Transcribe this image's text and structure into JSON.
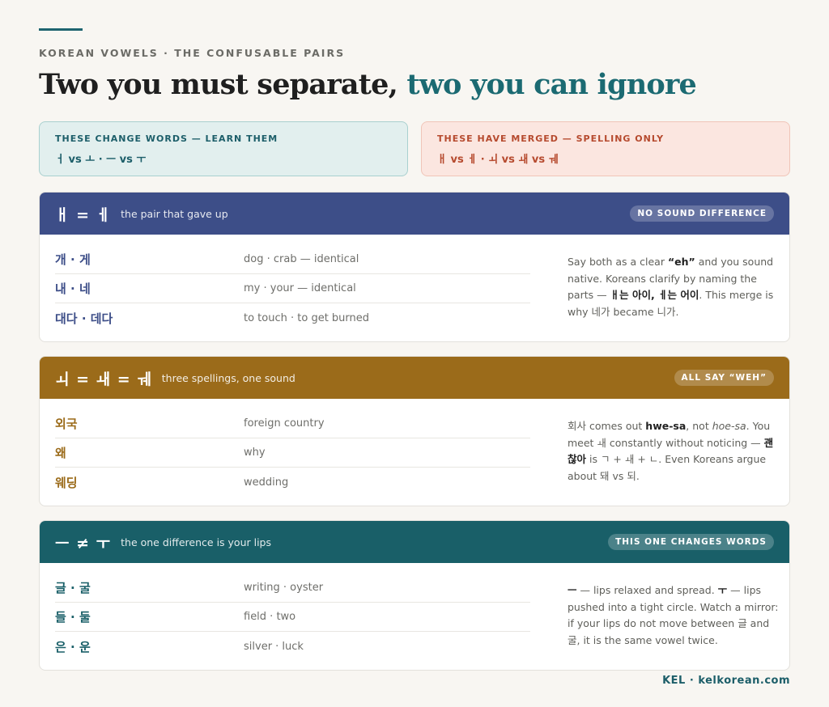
{
  "eyebrow": "KOREAN VOWELS · THE CONFUSABLE PAIRS",
  "headline": {
    "part1": "Two you must separate, ",
    "part2": "two you can ignore"
  },
  "callouts": {
    "learn": {
      "title": "THESE CHANGE WORDS — LEARN THEM",
      "body": "ㅓ vs ㅗ · ㅡ vs ㅜ"
    },
    "merged": {
      "title": "THESE HAVE MERGED — SPELLING ONLY",
      "body": "ㅐ vs ㅔ · ㅚ vs ㅙ vs ㅞ"
    }
  },
  "cards": [
    {
      "glyphs": "ㅐ = ㅔ",
      "subtitle": "the pair that gave up",
      "badge": "NO SOUND DIFFERENCE",
      "rows": [
        {
          "word": "개 · 게",
          "gloss": "dog · crab — identical"
        },
        {
          "word": "내 · 네",
          "gloss": "my · your — identical"
        },
        {
          "word": "대다 · 데다",
          "gloss": "to touch · to get burned"
        }
      ],
      "note": {
        "t1": "Say both as a clear ",
        "b1": "“eh”",
        "t2": " and you sound native. Koreans clarify by naming the parts — ",
        "b2": "ㅐ는 아이, ㅔ는 어이",
        "t3": ". This merge is why 네가 became 니가."
      }
    },
    {
      "glyphs": "ㅚ = ㅙ = ㅞ",
      "subtitle": "three spellings, one sound",
      "badge": "ALL SAY “WEH”",
      "rows": [
        {
          "word": "외국",
          "gloss": "foreign country"
        },
        {
          "word": "왜",
          "gloss": "why"
        },
        {
          "word": "웨딩",
          "gloss": "wedding"
        }
      ],
      "note": {
        "t1": "회사 comes out ",
        "b1": "hwe-sa",
        "t2": ", not ",
        "i1": "hoe-sa",
        "t3": ". You meet ㅙ constantly without noticing — ",
        "b2": "괜찮아",
        "t4": " is ㄱ + ㅙ + ㄴ. Even Koreans argue about 돼 vs 되."
      }
    },
    {
      "glyphs": "ㅡ ≠ ㅜ",
      "subtitle": "the one difference is your lips",
      "badge": "THIS ONE CHANGES WORDS",
      "rows": [
        {
          "word": "글 · 굴",
          "gloss": "writing · oyster"
        },
        {
          "word": "들 · 둘",
          "gloss": "field · two"
        },
        {
          "word": "은 · 운",
          "gloss": "silver · luck"
        }
      ],
      "note": {
        "b1": "ㅡ",
        "t1": " — lips relaxed and spread. ",
        "b2": "ㅜ",
        "t2": " — lips pushed into a tight circle. Watch a mirror: if your lips do not move between 글 and 굴, it is the same vowel twice."
      }
    }
  ],
  "footer": "KEL · kelkorean.com",
  "colors": {
    "teal": "#195f68",
    "indigo": "#3d4e88",
    "ochre": "#9b6b1a",
    "rose": "#b64a2e",
    "background": "#f8f6f2"
  }
}
